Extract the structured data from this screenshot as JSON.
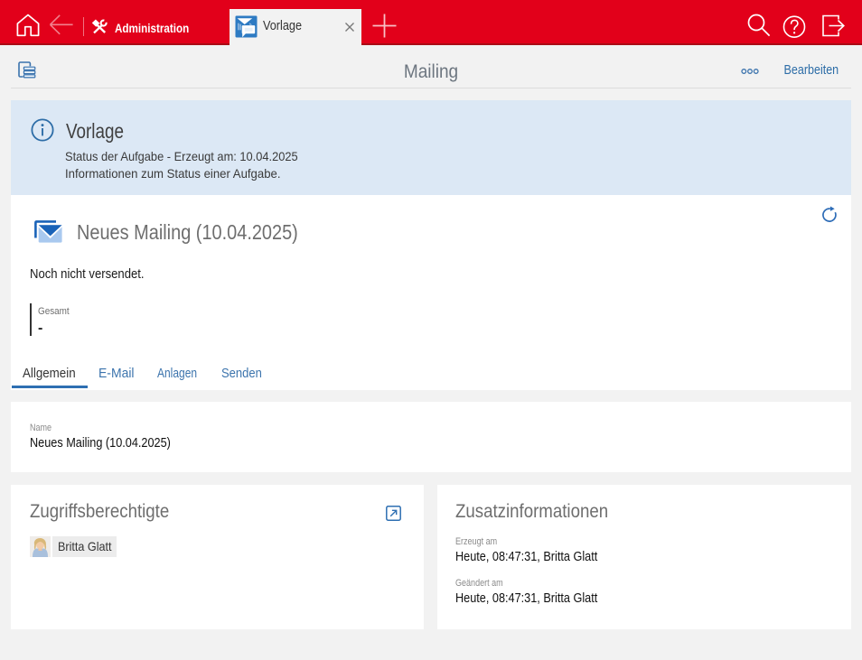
{
  "colors": {
    "brand_red": "#e2001a",
    "brand_red_dark": "#aa0c16",
    "accent_blue": "#2d6da7",
    "link_blue": "#3c74ad",
    "banner_bg": "#dce8f5",
    "page_bg": "#f2f2f2"
  },
  "topbar": {
    "app_label": "Administration",
    "tab": {
      "label": "Vorlage"
    },
    "icons": [
      "home-icon",
      "back-icon",
      "tools-icon",
      "vorlage-tab-icon",
      "close-icon",
      "new-tab-plus-icon",
      "search-icon",
      "help-icon",
      "logout-icon"
    ]
  },
  "toolbar": {
    "title": "Mailing",
    "edit_label": "Bearbeiten",
    "icons": [
      "document-stack-icon",
      "more-options-icon"
    ]
  },
  "banner": {
    "icon": "info-icon",
    "title": "Vorlage",
    "line1": "Status der Aufgabe - Erzeugt am: 10.04.2025",
    "line2": "Informationen zum Status einer Aufgabe."
  },
  "record": {
    "icon": "mailing-envelope-icon",
    "title": "Neues Mailing (10.04.2025)",
    "status": "Noch nicht versendet.",
    "stat": {
      "label": "Gesamt",
      "value": "-"
    },
    "refresh_icon": "refresh-icon"
  },
  "tabs": [
    {
      "label": "Allgemein",
      "active": true
    },
    {
      "label": "E-Mail",
      "active": false
    },
    {
      "label": "Anlagen",
      "active": false
    },
    {
      "label": "Senden",
      "active": false
    }
  ],
  "name_card": {
    "label": "Name",
    "value": "Neues Mailing (10.04.2025)"
  },
  "access_card": {
    "title": "Zugriffsberechtigte",
    "popout_icon": "external-link-icon",
    "member": {
      "avatar": "avatar-britta-glatt",
      "name": "Britta Glatt"
    }
  },
  "info_card": {
    "title": "Zusatzinformationen",
    "created_label": "Erzeugt am",
    "created_value": "Heute, 08:47:31, Britta Glatt",
    "modified_label": "Geändert am",
    "modified_value": "Heute, 08:47:31, Britta Glatt"
  }
}
